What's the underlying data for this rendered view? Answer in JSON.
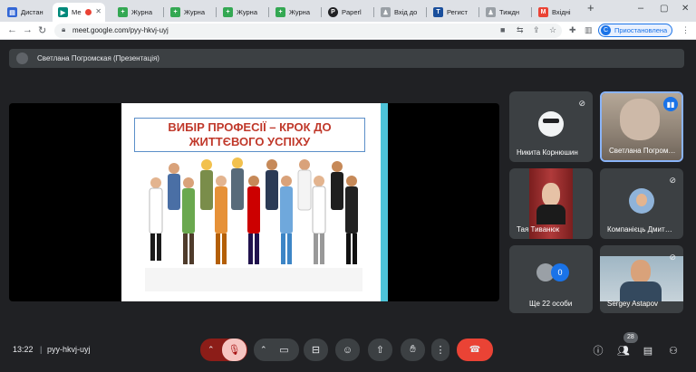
{
  "browser": {
    "tabs": [
      {
        "label": "Дистан",
        "fav": "#3367d6",
        "glyph": "▤"
      },
      {
        "label": "Ме",
        "fav": "#00897b",
        "glyph": "▶"
      },
      {
        "label": "Журна",
        "fav": "#34a853",
        "glyph": "+"
      },
      {
        "label": "Журна",
        "fav": "#34a853",
        "glyph": "+"
      },
      {
        "label": "Журна",
        "fav": "#34a853",
        "glyph": "+"
      },
      {
        "label": "Журна",
        "fav": "#34a853",
        "glyph": "+"
      },
      {
        "label": "Paperl",
        "fav": "#202124",
        "glyph": "P"
      },
      {
        "label": "Вхід до",
        "fav": "#9aa0a6",
        "glyph": "♟"
      },
      {
        "label": "Регист",
        "fav": "#1a4f9c",
        "glyph": "T"
      },
      {
        "label": "Тиждн",
        "fav": "#9aa0a6",
        "glyph": "♟"
      },
      {
        "label": "Вхідні",
        "fav": "#ea4335",
        "glyph": "M"
      }
    ],
    "new_tab": "+",
    "url": "meet.google.com/pyy-hkvj-uyj",
    "profile_initial": "С",
    "profile_label": "Приостановлена"
  },
  "meet": {
    "presenter_banner": "Светлана Погромская (Презентація)",
    "slide_title": "ВИБІР ПРОФЕСІЇ – КРОК ДО ЖИТТЄВОГО УСПІХУ",
    "participants": [
      {
        "name": "Никита Корнюшин"
      },
      {
        "name": "Светлана Погром…"
      },
      {
        "name": "Тая Тиванюк"
      },
      {
        "name": "Компанієць Дмит…"
      },
      {
        "name": "Ще 22 особи",
        "extra": "0"
      },
      {
        "name": "Sergey Astapov"
      }
    ],
    "time": "13:22",
    "meeting_code": "pyy-hkvj-uyj",
    "participant_count": "28"
  },
  "colors": {
    "leave": "#ea4335",
    "mic_off": "#f6c5c1",
    "accent": "#1a73e8",
    "slide_title": "#c0392b",
    "slide_accent": "#4dc3d8"
  }
}
